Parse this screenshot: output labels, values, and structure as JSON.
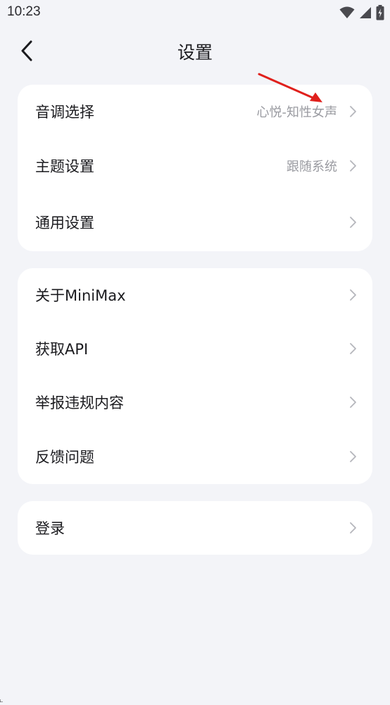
{
  "status_bar": {
    "time": "10:23",
    "icons": [
      "wifi-icon",
      "signal-icon",
      "battery-charging-icon"
    ]
  },
  "header": {
    "back_icon": "chevron-left-icon",
    "title": "设置"
  },
  "groups": [
    {
      "items": [
        {
          "label": "音调选择",
          "value": "心悦-知性女声",
          "icon": "chevron-right-icon"
        },
        {
          "label": "主题设置",
          "value": "跟随系统",
          "icon": "chevron-right-icon"
        },
        {
          "label": "通用设置",
          "value": "",
          "icon": "chevron-right-icon"
        }
      ]
    },
    {
      "items": [
        {
          "label": "关于MiniMax",
          "icon": "chevron-right-icon"
        },
        {
          "label": "获取API",
          "icon": "chevron-right-icon"
        },
        {
          "label": "举报违规内容",
          "icon": "chevron-right-icon"
        },
        {
          "label": "反馈问题",
          "icon": "chevron-right-icon"
        }
      ]
    },
    {
      "items": [
        {
          "label": "登录",
          "icon": "chevron-right-icon"
        }
      ]
    }
  ],
  "colors": {
    "background": "#f3f4f8",
    "card": "#ffffff",
    "primary_text": "#1b1b1f",
    "secondary_text": "#9a9ba1",
    "chevron": "#b5b6bc",
    "annotation_arrow": "#e0201c"
  }
}
